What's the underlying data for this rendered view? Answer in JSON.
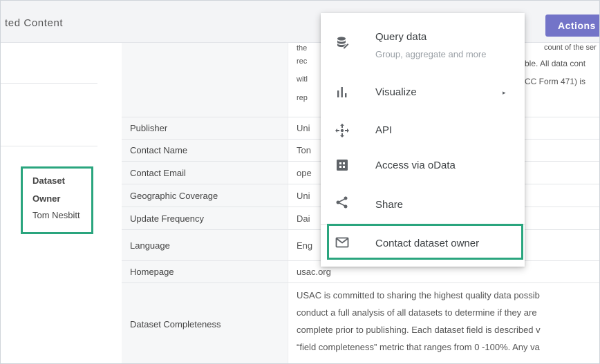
{
  "header": {
    "title": "ted Content",
    "actions_label": "Actions",
    "actions_chevron": "⌄"
  },
  "owner": {
    "label_line1": "Dataset",
    "label_line2": "Owner",
    "name": "Tom Nesbitt"
  },
  "metadata": {
    "top_desc_lines": [
      "the",
      "rec",
      "witl",
      "rep"
    ],
    "top_desc_right": [
      "count of the ser",
      "ble. All data cont",
      "CC Form 471) is",
      ""
    ],
    "rows": [
      {
        "key": "Publisher",
        "value": "Uni"
      },
      {
        "key": "Contact Name",
        "value": "Ton"
      },
      {
        "key": "Contact Email",
        "value": "ope"
      },
      {
        "key": "Geographic Coverage",
        "value": "Uni"
      },
      {
        "key": "Update Frequency",
        "value": "Dai"
      },
      {
        "key": "Language",
        "value": "Eng"
      },
      {
        "key": "Homepage",
        "value": "usac.org"
      }
    ],
    "completeness": {
      "key": "Dataset Completeness",
      "lines": [
        "USAC is committed to sharing the highest quality data possib",
        "conduct a full analysis of all datasets to determine if they are",
        "complete prior to publishing. Each dataset field is described v",
        "“field completeness” metric that ranges from 0 -100%. Any va"
      ]
    }
  },
  "menu": {
    "items": [
      {
        "label": "Query data",
        "sublabel": "Group, aggregate and more",
        "icon": "database-icon"
      },
      {
        "label": "Visualize",
        "icon": "bar-chart-icon",
        "has_submenu": true
      },
      {
        "label": "API",
        "icon": "api-icon"
      },
      {
        "label": "Access via oData",
        "icon": "odata-icon"
      },
      {
        "label": "Share",
        "icon": "share-icon"
      },
      {
        "label": "Contact dataset owner",
        "icon": "mail-icon"
      }
    ],
    "submenu_arrow": "▸"
  },
  "colors": {
    "accent": "#7374c8",
    "highlight": "#2aa57e"
  }
}
